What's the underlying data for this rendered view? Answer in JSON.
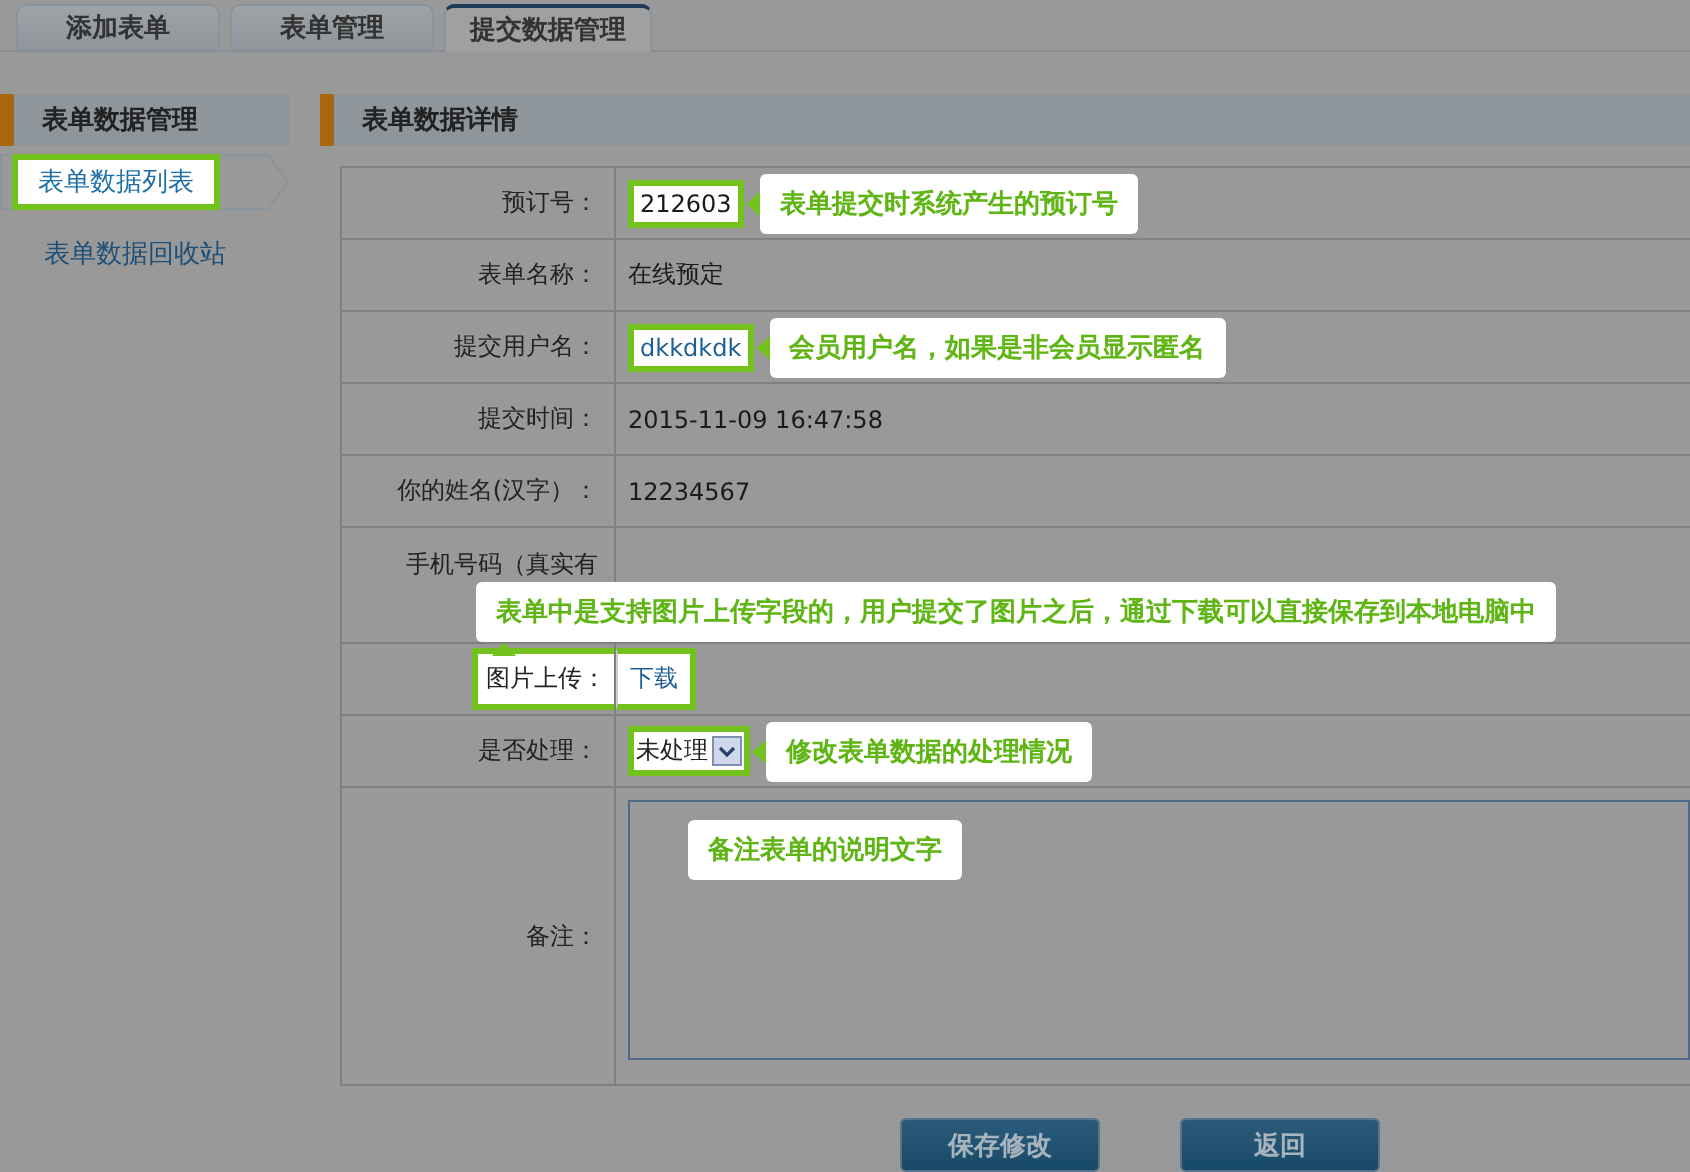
{
  "tabs": [
    {
      "label": "添加表单",
      "selected": false
    },
    {
      "label": "表单管理",
      "selected": false
    },
    {
      "label": "提交数据管理",
      "selected": true
    }
  ],
  "sidebar": {
    "title": "表单数据管理",
    "items": [
      {
        "label": "表单数据列表",
        "selected": true,
        "highlighted": true
      },
      {
        "label": "表单数据回收站",
        "selected": false,
        "highlighted": false
      }
    ]
  },
  "detail": {
    "title": "表单数据详情",
    "rows": [
      {
        "kind": "text",
        "label": "预订号：",
        "value": "212603",
        "highlighted": true,
        "note": "表单提交时系统产生的预订号"
      },
      {
        "kind": "text",
        "label": "表单名称：",
        "value": "在线预定"
      },
      {
        "kind": "link",
        "label": "提交用户名：",
        "value": "dkkdkdk",
        "highlighted": true,
        "note": "会员用户名，如果是非会员显示匿名"
      },
      {
        "kind": "text",
        "label": "提交时间：",
        "value": "2015-11-09 16:47:58"
      },
      {
        "kind": "text",
        "label": "你的姓名(汉字）：",
        "value": "12234567"
      },
      {
        "kind": "tall",
        "label": "手机号码（真实有"
      },
      {
        "kind": "download",
        "label": "图片上传：",
        "value": "下载",
        "highlighted": true,
        "note": "表单中是支持图片上传字段的，用户提交了图片之后，通过下载可以直接保存到本地电脑中"
      },
      {
        "kind": "select",
        "label": "是否处理：",
        "value": "未处理",
        "highlighted": true,
        "note": "修改表单数据的处理情况"
      },
      {
        "kind": "textarea",
        "label": "备注：",
        "note": "备注表单的说明文字"
      }
    ]
  },
  "buttons": [
    {
      "label": "保存修改"
    },
    {
      "label": "返回"
    }
  ]
}
